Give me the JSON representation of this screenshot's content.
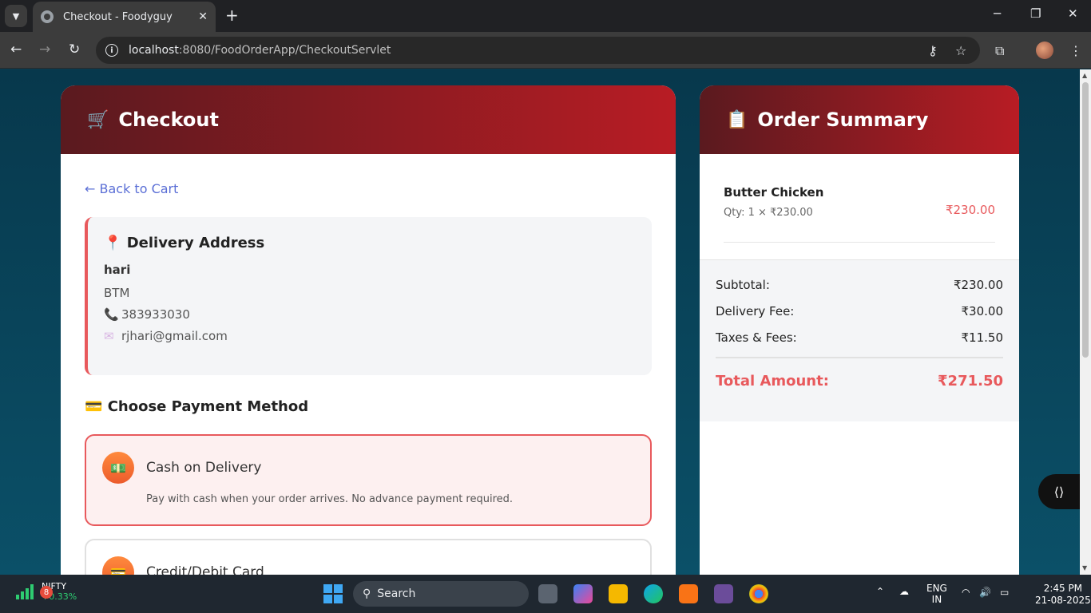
{
  "browser": {
    "tab_title": "Checkout - Foodyguy",
    "url_host": "localhost",
    "url_rest": ":8080/FoodOrderApp/CheckoutServlet"
  },
  "checkout": {
    "title": "Checkout",
    "title_icon": "🛒",
    "back_link": "← Back to Cart",
    "address": {
      "heading": "Delivery Address",
      "heading_icon": "📍",
      "name": "hari",
      "area": "BTM",
      "phone_icon": "📞",
      "phone": "383933030",
      "email_icon": "✉",
      "email": "rjhari@gmail.com"
    },
    "payment": {
      "heading": "Choose Payment Method",
      "heading_icon": "💳",
      "options": [
        {
          "label": "Cash on Delivery",
          "icon": "💵",
          "description": "Pay with cash when your order arrives. No advance payment required."
        },
        {
          "label": "Credit/Debit Card",
          "icon": "💳",
          "description": ""
        }
      ]
    }
  },
  "summary": {
    "title": "Order Summary",
    "title_icon": "📋",
    "items": [
      {
        "name": "Butter Chicken",
        "qty_text": "Qty: 1 × ₹230.00",
        "price": "₹230.00"
      }
    ],
    "subtotal_label": "Subtotal:",
    "subtotal": "₹230.00",
    "delivery_label": "Delivery Fee:",
    "delivery": "₹30.00",
    "taxes_label": "Taxes & Fees:",
    "taxes": "₹11.50",
    "total_label": "Total Amount:",
    "total": "₹271.50"
  },
  "taskbar": {
    "nifty_badge": "8",
    "nifty_label": "NIFTY",
    "nifty_change": "+0.33%",
    "search_label": "Search",
    "lang_top": "ENG",
    "lang_bottom": "IN",
    "time": "2:45 PM",
    "date": "21-08-2025"
  },
  "colors": {
    "accent": "#e8595c",
    "header_start": "#5a1a1f",
    "header_end": "#b81c24",
    "link": "#5b6fd6"
  }
}
